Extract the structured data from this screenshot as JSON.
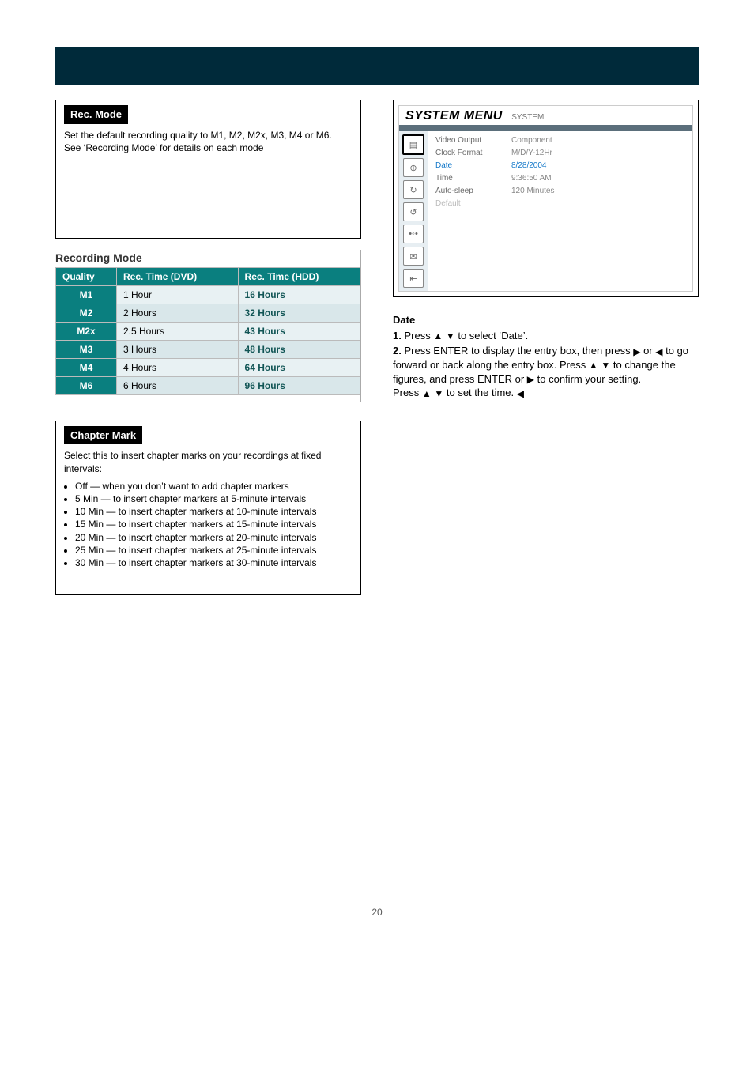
{
  "recMode": {
    "title": "Rec. Mode",
    "text": "Set the default recording quality to M1, M2, M2x, M3, M4 or M6.\nSee ‘Recording Mode’ for details on each mode"
  },
  "recModeTable": {
    "title": "Recording Mode",
    "cols": [
      "Quality",
      "Rec. Time (DVD)",
      "Rec. Time (HDD)"
    ],
    "rows": [
      {
        "q": "M1",
        "dvd": "1 Hour",
        "hdd": "16 Hours"
      },
      {
        "q": "M2",
        "dvd": "2 Hours",
        "hdd": "32 Hours"
      },
      {
        "q": "M2x",
        "dvd": "2.5 Hours",
        "hdd": "43 Hours"
      },
      {
        "q": "M3",
        "dvd": "3 Hours",
        "hdd": "48 Hours"
      },
      {
        "q": "M4",
        "dvd": "4 Hours",
        "hdd": "64 Hours"
      },
      {
        "q": "M6",
        "dvd": "6 Hours",
        "hdd": "96 Hours"
      }
    ]
  },
  "chapterMark": {
    "title": "Chapter Mark",
    "intro": "Select this to insert chapter marks on your recordings at fixed intervals:",
    "items": [
      "Off — when you don’t want to add chapter markers",
      "5 Min — to insert chapter markers at 5-minute intervals",
      "10 Min — to insert chapter markers at 10-minute intervals",
      "15 Min — to insert chapter markers at 15-minute intervals",
      "20 Min — to insert chapter markers at 20-minute intervals",
      "25 Min — to insert chapter markers at 25-minute intervals",
      "30 Min — to insert chapter markers at 30-minute intervals"
    ]
  },
  "sysMenu": {
    "title": "SYSTEM MENU",
    "tag": "SYSTEM",
    "icons": [
      "sys",
      "lang",
      "play-a",
      "play-b",
      "audio",
      "gv",
      "exit"
    ],
    "rows": [
      {
        "k": "Video Output",
        "v": "Component"
      },
      {
        "k": "Clock Format",
        "v": "M/D/Y-12Hr"
      },
      {
        "k": "Date",
        "v": "8/28/2004",
        "state": "sel"
      },
      {
        "k": "Time",
        "v": "9:36:50 AM"
      },
      {
        "k": "Auto-sleep",
        "v": "120 Minutes"
      },
      {
        "k": "Default",
        "v": "",
        "state": "dim"
      }
    ]
  },
  "steps": {
    "intro": "Date",
    "s1": {
      "label": "1.",
      "text_a": "Press ",
      "text_b": " to select ‘Date’."
    },
    "s2": {
      "label": "2.",
      "text_a": "Press ENTER to display the entry box, then press ",
      "text_b": " or ",
      "text_c": " to go forward or back along the entry box. Press ",
      "text_d": " to change the figures, and press ENTER or ",
      "text_e": " to confirm your setting.\nPress ",
      "text_f": " to set the time."
    }
  },
  "pageNumber": "20"
}
